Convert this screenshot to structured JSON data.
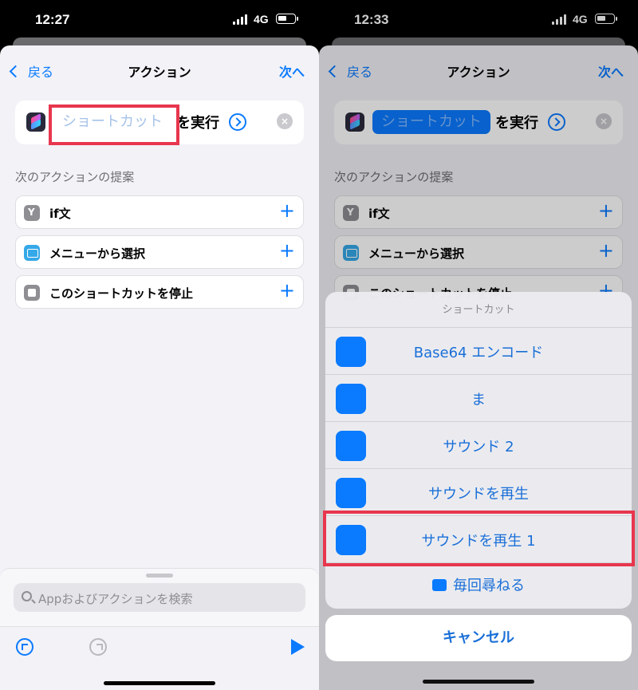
{
  "left": {
    "status": {
      "time": "12:27",
      "network": "4G"
    },
    "nav": {
      "back": "戻る",
      "title": "アクション",
      "next": "次へ"
    },
    "action": {
      "token": "ショートカット",
      "run": "を実行",
      "clear": "×"
    },
    "section_label": "次のアクションの提案",
    "suggestions": [
      {
        "label": "if文",
        "icon": "if-icon"
      },
      {
        "label": "メニューから選択",
        "icon": "menu-icon"
      },
      {
        "label": "このショートカットを停止",
        "icon": "stop-icon"
      }
    ],
    "plus": "+",
    "search_placeholder": "Appおよびアクションを検索"
  },
  "right": {
    "status": {
      "time": "12:33",
      "network": "4G"
    },
    "nav": {
      "back": "戻る",
      "title": "アクション",
      "next": "次へ"
    },
    "action": {
      "token": "ショートカット",
      "run": "を実行",
      "clear": "×"
    },
    "section_label": "次のアクションの提案",
    "suggestions": [
      {
        "label": "if文",
        "icon": "if-icon"
      },
      {
        "label": "メニューから選択",
        "icon": "menu-icon"
      },
      {
        "label": "このショートカットを停止",
        "icon": "stop-icon"
      }
    ],
    "plus": "+",
    "picker": {
      "header": "ショートカット",
      "items": [
        "Base64 エンコード",
        "ま",
        "サウンド 2",
        "サウンドを再生",
        "サウンドを再生 1"
      ],
      "ask": "毎回尋ねる",
      "cancel": "キャンセル"
    }
  },
  "colors": {
    "accent": "#0a7aff",
    "highlight": "#e8364e",
    "sheet_bg": "#f2f2f7"
  }
}
